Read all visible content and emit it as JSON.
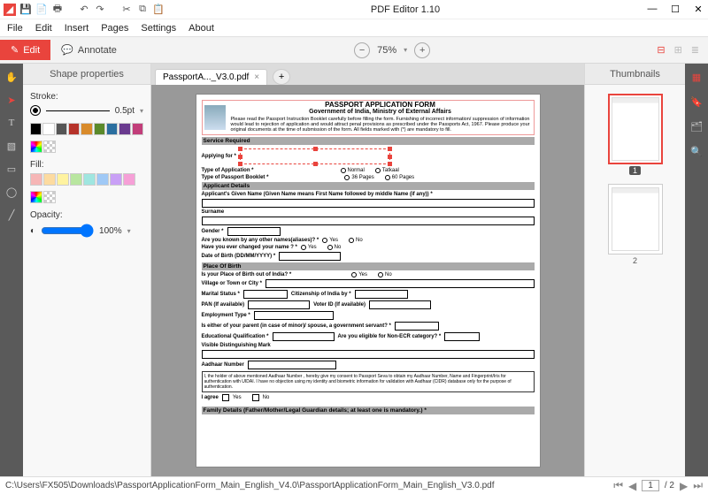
{
  "app": {
    "title": "PDF Editor 1.10"
  },
  "menu": [
    "File",
    "Edit",
    "Insert",
    "Pages",
    "Settings",
    "About"
  ],
  "toolbar": {
    "edit_label": "Edit",
    "annotate_label": "Annotate",
    "zoom": "75%"
  },
  "left_panel": {
    "title": "Shape properties",
    "stroke_label": "Stroke:",
    "stroke_value": "0.5pt",
    "fill_label": "Fill:",
    "opacity_label": "Opacity:",
    "opacity_value": "100%"
  },
  "stroke_colors": [
    "#000000",
    "#ffffff",
    "#555555",
    "#b6332a",
    "#d98b2b",
    "#5b8a2b",
    "#2b6fa0",
    "#6a3b8f",
    "#c23e7a"
  ],
  "fill_colors": [
    "#f6b6b6",
    "#fddba0",
    "#fff3a0",
    "#b9e6a0",
    "#a0e6e0",
    "#a0c9f6",
    "#c9a0f6",
    "#f6a0d7"
  ],
  "tab": {
    "name": "PassportA..._V3.0.pdf"
  },
  "thumbs": {
    "title": "Thumbnails",
    "page1": "1",
    "page2": "2"
  },
  "right_panel": {},
  "status": {
    "path": "C:\\Users\\FX505\\Downloads\\PassportApplicationForm_Main_English_V4.0\\PassportApplicationForm_Main_English_V3.0.pdf",
    "page_field": "1",
    "page_total": "/ 2"
  },
  "doc": {
    "title": "PASSPORT APPLICATION FORM",
    "subtitle": "Government of India, Ministry of External Affairs",
    "instructions": "Please read the Passport Instruction Booklet carefully before filling the form. Furnishing of incorrect information/ suppression of information would lead to rejection of application and would attract penal provisions as prescribed under the Passports Act, 1967. Please produce your original documents at the time of submission of the form. All fields marked with (*) are mandatory to fill.",
    "sec_service": "Service Required",
    "applying_for": "Applying for *",
    "type_app": "Type of Application *",
    "opt_normal": "Normal",
    "opt_tatkaal": "Tatkaal",
    "type_booklet": "Type of Passport Booklet *",
    "opt_36": "36 Pages",
    "opt_60": "60 Pages",
    "sec_applicant": "Applicant Details",
    "given_name": "Applicant's Given Name (Given Name means First Name followed by middle Name (if any)) *",
    "surname": "Surname",
    "gender": "Gender *",
    "aliases": "Are you known by any other names(aliases)? *",
    "changed_name": "Have you ever changed your name ? *",
    "yes": "Yes",
    "no": "No",
    "dob": "Date of Birth (DD/MM/YYYY) *",
    "sec_place": "Place Of Birth",
    "pob_out": "Is your Place of Birth out of India? *",
    "village": "Village or Town or City *",
    "marital": "Marital Status *",
    "citizenship": "Citizenship of India by *",
    "pan": "PAN (If available)",
    "voter": "Voter ID (If available)",
    "employment": "Employment Type *",
    "parent_gov": "Is either of your parent (in case of minor)/ spouse, a government servant? *",
    "edu": "Educational Qualification *",
    "non_ecr": "Are you eligible for Non-ECR category? *",
    "dist_mark": "Visible Distinguishing Mark",
    "aadhaar": "Aadhaar Number",
    "aadhaar_consent": "I, the holder of above mentioned Aadhaar Number , hereby give my consent to Passport Seva to obtain my Aadhaar Number, Name and Fingerprint/Iris for authentication with UIDAI. I have no objection using my identity and biometric information for validation with Aadhaar (CIDR) database only for the purpose of authentication.",
    "i_agree": "I agree",
    "sec_family": "Family Details (Father/Mother/Legal Guardian details; at least one is mandatory.) *"
  }
}
